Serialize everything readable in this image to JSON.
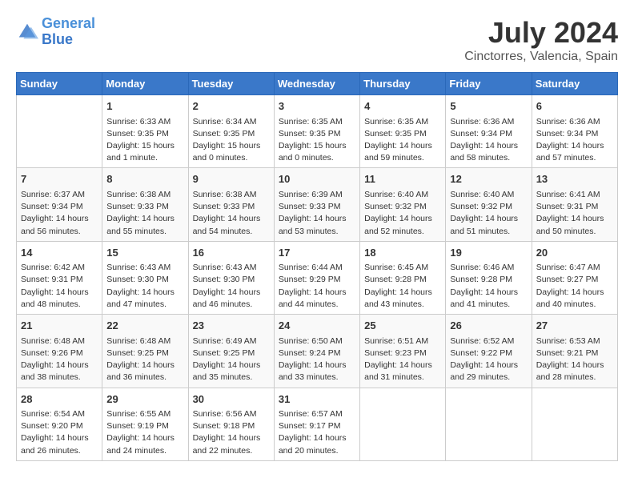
{
  "logo": {
    "line1": "General",
    "line2": "Blue"
  },
  "title": "July 2024",
  "subtitle": "Cinctorres, Valencia, Spain",
  "days_header": [
    "Sunday",
    "Monday",
    "Tuesday",
    "Wednesday",
    "Thursday",
    "Friday",
    "Saturday"
  ],
  "weeks": [
    [
      {
        "num": "",
        "info": ""
      },
      {
        "num": "1",
        "info": "Sunrise: 6:33 AM\nSunset: 9:35 PM\nDaylight: 15 hours\nand 1 minute."
      },
      {
        "num": "2",
        "info": "Sunrise: 6:34 AM\nSunset: 9:35 PM\nDaylight: 15 hours\nand 0 minutes."
      },
      {
        "num": "3",
        "info": "Sunrise: 6:35 AM\nSunset: 9:35 PM\nDaylight: 15 hours\nand 0 minutes."
      },
      {
        "num": "4",
        "info": "Sunrise: 6:35 AM\nSunset: 9:35 PM\nDaylight: 14 hours\nand 59 minutes."
      },
      {
        "num": "5",
        "info": "Sunrise: 6:36 AM\nSunset: 9:34 PM\nDaylight: 14 hours\nand 58 minutes."
      },
      {
        "num": "6",
        "info": "Sunrise: 6:36 AM\nSunset: 9:34 PM\nDaylight: 14 hours\nand 57 minutes."
      }
    ],
    [
      {
        "num": "7",
        "info": "Sunrise: 6:37 AM\nSunset: 9:34 PM\nDaylight: 14 hours\nand 56 minutes."
      },
      {
        "num": "8",
        "info": "Sunrise: 6:38 AM\nSunset: 9:33 PM\nDaylight: 14 hours\nand 55 minutes."
      },
      {
        "num": "9",
        "info": "Sunrise: 6:38 AM\nSunset: 9:33 PM\nDaylight: 14 hours\nand 54 minutes."
      },
      {
        "num": "10",
        "info": "Sunrise: 6:39 AM\nSunset: 9:33 PM\nDaylight: 14 hours\nand 53 minutes."
      },
      {
        "num": "11",
        "info": "Sunrise: 6:40 AM\nSunset: 9:32 PM\nDaylight: 14 hours\nand 52 minutes."
      },
      {
        "num": "12",
        "info": "Sunrise: 6:40 AM\nSunset: 9:32 PM\nDaylight: 14 hours\nand 51 minutes."
      },
      {
        "num": "13",
        "info": "Sunrise: 6:41 AM\nSunset: 9:31 PM\nDaylight: 14 hours\nand 50 minutes."
      }
    ],
    [
      {
        "num": "14",
        "info": "Sunrise: 6:42 AM\nSunset: 9:31 PM\nDaylight: 14 hours\nand 48 minutes."
      },
      {
        "num": "15",
        "info": "Sunrise: 6:43 AM\nSunset: 9:30 PM\nDaylight: 14 hours\nand 47 minutes."
      },
      {
        "num": "16",
        "info": "Sunrise: 6:43 AM\nSunset: 9:30 PM\nDaylight: 14 hours\nand 46 minutes."
      },
      {
        "num": "17",
        "info": "Sunrise: 6:44 AM\nSunset: 9:29 PM\nDaylight: 14 hours\nand 44 minutes."
      },
      {
        "num": "18",
        "info": "Sunrise: 6:45 AM\nSunset: 9:28 PM\nDaylight: 14 hours\nand 43 minutes."
      },
      {
        "num": "19",
        "info": "Sunrise: 6:46 AM\nSunset: 9:28 PM\nDaylight: 14 hours\nand 41 minutes."
      },
      {
        "num": "20",
        "info": "Sunrise: 6:47 AM\nSunset: 9:27 PM\nDaylight: 14 hours\nand 40 minutes."
      }
    ],
    [
      {
        "num": "21",
        "info": "Sunrise: 6:48 AM\nSunset: 9:26 PM\nDaylight: 14 hours\nand 38 minutes."
      },
      {
        "num": "22",
        "info": "Sunrise: 6:48 AM\nSunset: 9:25 PM\nDaylight: 14 hours\nand 36 minutes."
      },
      {
        "num": "23",
        "info": "Sunrise: 6:49 AM\nSunset: 9:25 PM\nDaylight: 14 hours\nand 35 minutes."
      },
      {
        "num": "24",
        "info": "Sunrise: 6:50 AM\nSunset: 9:24 PM\nDaylight: 14 hours\nand 33 minutes."
      },
      {
        "num": "25",
        "info": "Sunrise: 6:51 AM\nSunset: 9:23 PM\nDaylight: 14 hours\nand 31 minutes."
      },
      {
        "num": "26",
        "info": "Sunrise: 6:52 AM\nSunset: 9:22 PM\nDaylight: 14 hours\nand 29 minutes."
      },
      {
        "num": "27",
        "info": "Sunrise: 6:53 AM\nSunset: 9:21 PM\nDaylight: 14 hours\nand 28 minutes."
      }
    ],
    [
      {
        "num": "28",
        "info": "Sunrise: 6:54 AM\nSunset: 9:20 PM\nDaylight: 14 hours\nand 26 minutes."
      },
      {
        "num": "29",
        "info": "Sunrise: 6:55 AM\nSunset: 9:19 PM\nDaylight: 14 hours\nand 24 minutes."
      },
      {
        "num": "30",
        "info": "Sunrise: 6:56 AM\nSunset: 9:18 PM\nDaylight: 14 hours\nand 22 minutes."
      },
      {
        "num": "31",
        "info": "Sunrise: 6:57 AM\nSunset: 9:17 PM\nDaylight: 14 hours\nand 20 minutes."
      },
      {
        "num": "",
        "info": ""
      },
      {
        "num": "",
        "info": ""
      },
      {
        "num": "",
        "info": ""
      }
    ]
  ]
}
